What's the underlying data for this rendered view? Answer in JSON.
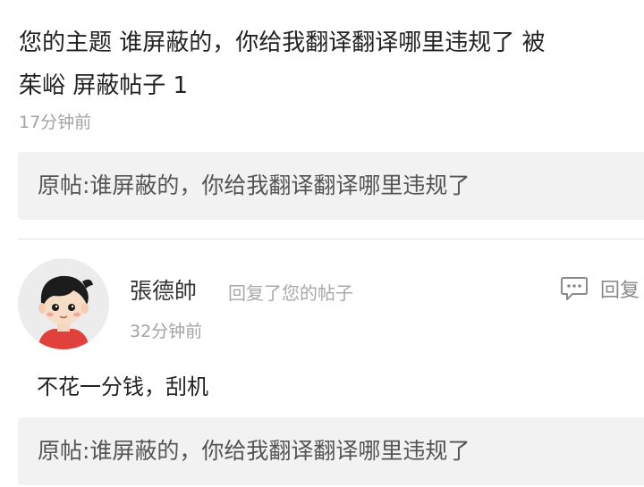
{
  "notification": {
    "line1": "您的主题 谁屏蔽的，你给我翻译翻译哪里违规了 被",
    "line2": "茱峪 屏蔽帖子 1",
    "time": "17分钟前",
    "quote": "原帖:谁屏蔽的，你给我翻译翻译哪里违规了"
  },
  "reply": {
    "author": "張德帥",
    "action_note": "回复了您的帖子",
    "time": "32分钟前",
    "reply_button_label": "回复",
    "reply_icon": "comment-bubble-icon",
    "content": "不花一分钱，刮机",
    "quote": "原帖:谁屏蔽的，你给我翻译翻译哪里违规了"
  },
  "colors": {
    "quote_background": "#f2f2f2",
    "secondary_text": "#a3a3a3",
    "avatar_shirt": "#e0413b"
  }
}
